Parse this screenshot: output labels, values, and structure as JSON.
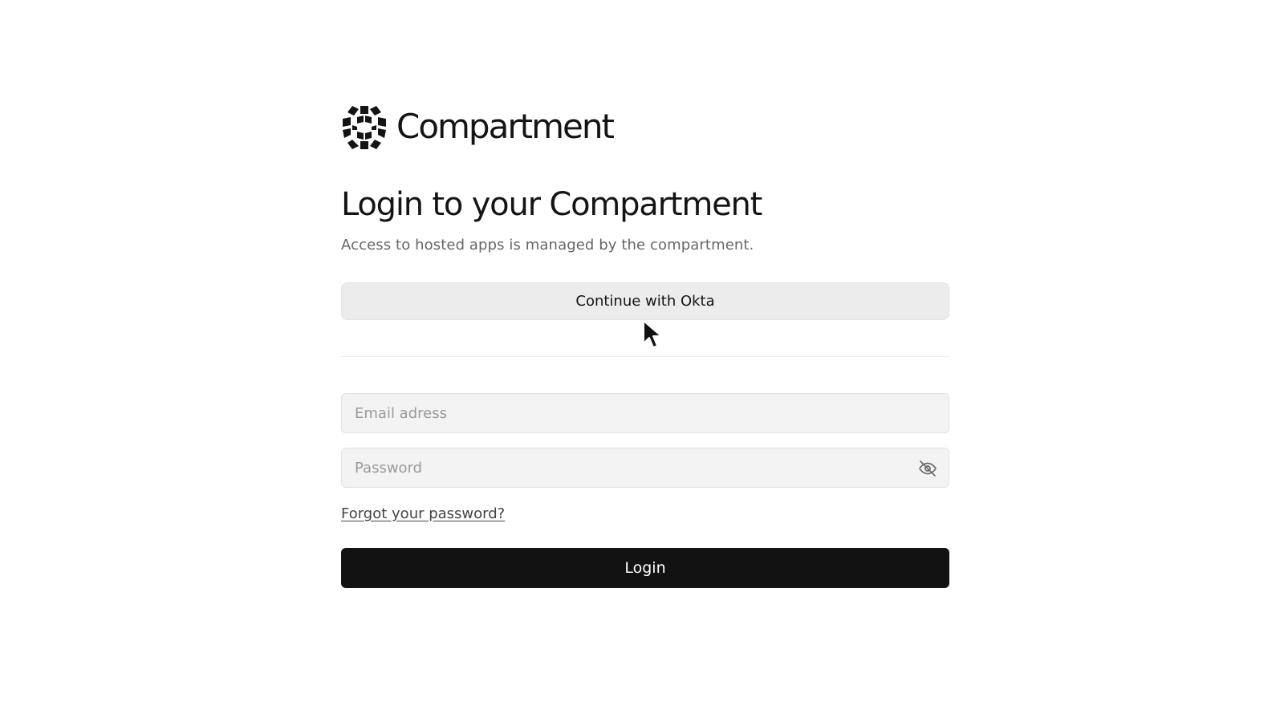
{
  "brand": {
    "name": "Compartment",
    "logo_icon": "cube-cluster-logo-icon"
  },
  "login": {
    "title": "Login to your Compartment",
    "subtitle": "Access to hosted apps is managed by the compartment.",
    "okta_button_label": "Continue with Okta",
    "email_placeholder": "Email adress",
    "email_value": "",
    "password_placeholder": "Password",
    "password_value": "",
    "password_toggle_icon": "eye-off-icon",
    "forgot_password_label": "Forgot your password?",
    "login_button_label": "Login"
  },
  "colors": {
    "primary_button": "#121212",
    "secondary_button": "#ececec",
    "input_background": "#f3f3f3"
  }
}
